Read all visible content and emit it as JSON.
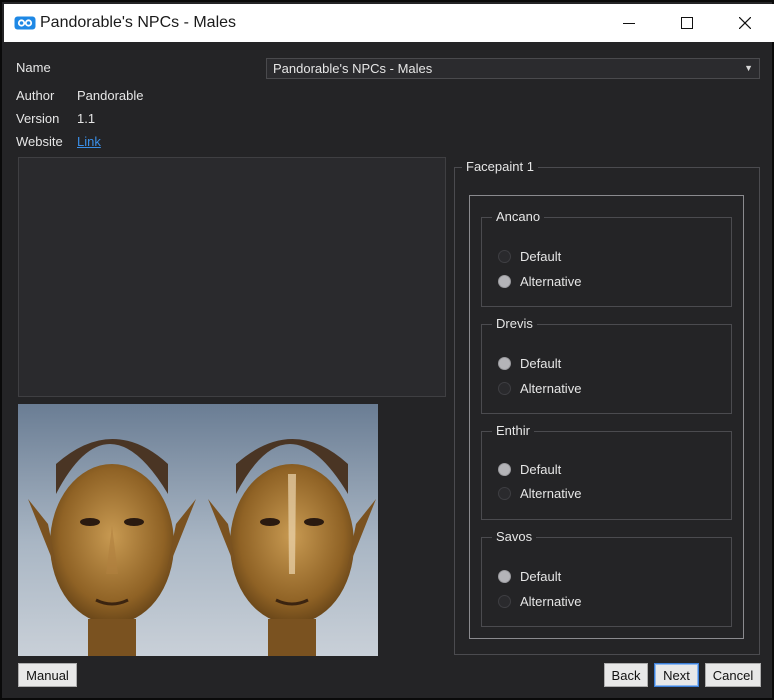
{
  "window": {
    "title": "Pandorable's NPCs - Males"
  },
  "info": {
    "name_label": "Name",
    "name_value": "Pandorable's NPCs - Males",
    "author_label": "Author",
    "author_value": "Pandorable",
    "version_label": "Version",
    "version_value": "1.1",
    "website_label": "Website",
    "website_link": "Link"
  },
  "options": {
    "group_title": "Facepaint 1",
    "groups": [
      {
        "title": "Ancano",
        "options": [
          "Default",
          "Alternative"
        ],
        "selected": 1
      },
      {
        "title": "Drevis",
        "options": [
          "Default",
          "Alternative"
        ],
        "selected": 0
      },
      {
        "title": "Enthir",
        "options": [
          "Default",
          "Alternative"
        ],
        "selected": 0
      },
      {
        "title": "Savos",
        "options": [
          "Default",
          "Alternative"
        ],
        "selected": 0
      }
    ]
  },
  "buttons": {
    "manual": "Manual",
    "back": "Back",
    "next": "Next",
    "cancel": "Cancel"
  },
  "colors": {
    "background": "#242426",
    "link": "#3a8ee6",
    "accent_border": "#3c7fd8"
  }
}
